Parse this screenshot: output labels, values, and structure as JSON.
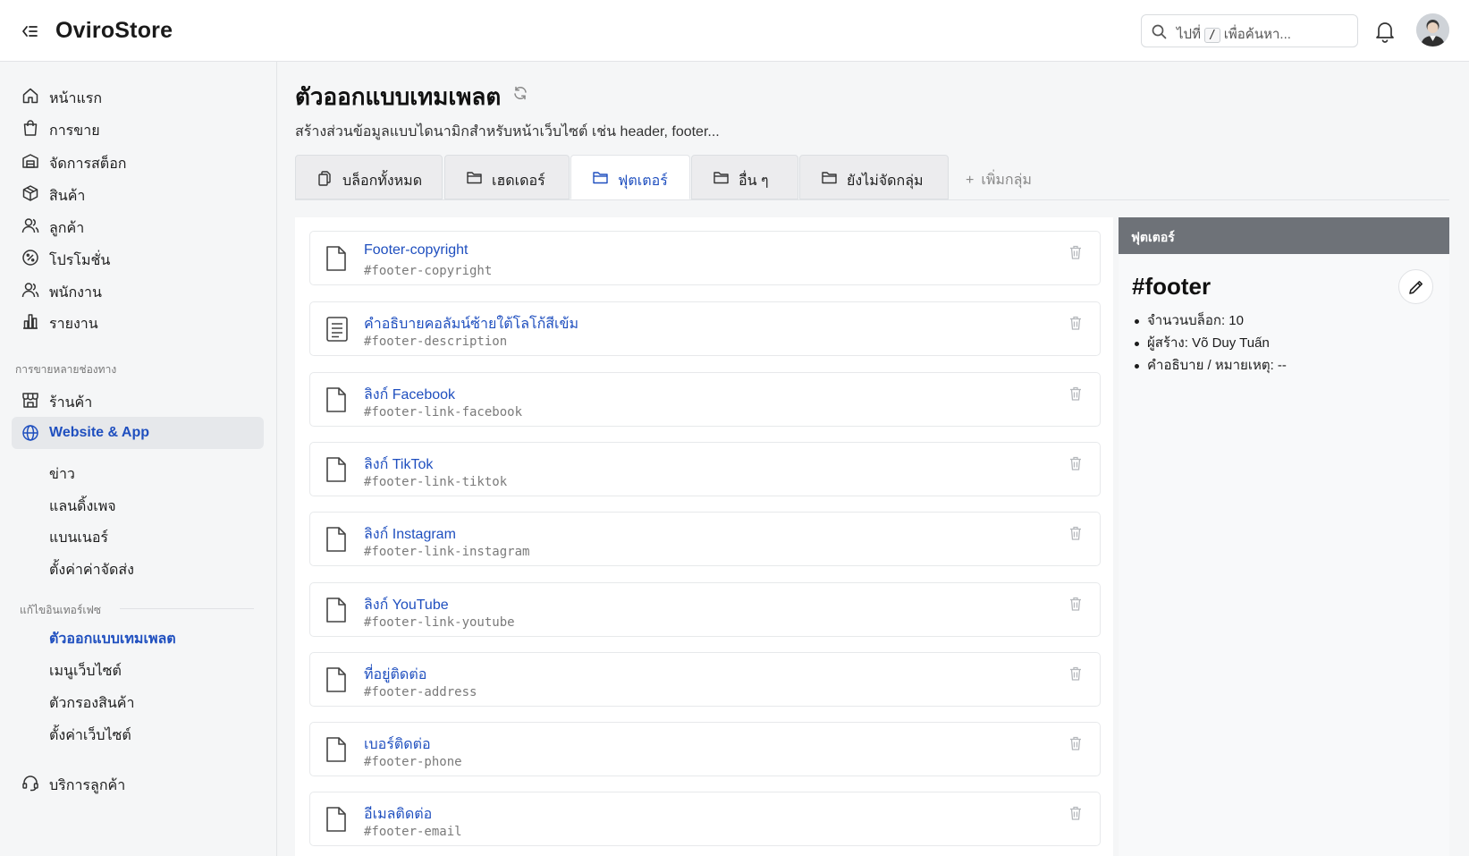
{
  "app": {
    "brand": "OviroStore"
  },
  "search": {
    "prefix": "ไปที่",
    "key": "/",
    "suffix": "เพื่อค้นหา..."
  },
  "sidebar": {
    "items": [
      {
        "label": "หน้าแรก",
        "icon": "home-icon"
      },
      {
        "label": "การขาย",
        "icon": "shopping-bag-icon"
      },
      {
        "label": "จัดการสต็อก",
        "icon": "warehouse-icon"
      },
      {
        "label": "สินค้า",
        "icon": "box-icon"
      },
      {
        "label": "ลูกค้า",
        "icon": "users-icon"
      },
      {
        "label": "โปรโมชั่น",
        "icon": "percent-icon"
      },
      {
        "label": "พนักงาน",
        "icon": "staff-icon"
      },
      {
        "label": "รายงาน",
        "icon": "bar-chart-icon"
      }
    ],
    "section_channels": "การขายหลายช่องทาง",
    "channels": [
      {
        "label": "ร้านค้า",
        "icon": "store-icon"
      },
      {
        "label": "Website & App",
        "icon": "globe-icon"
      }
    ],
    "website_sub": [
      "ข่าว",
      "แลนดิ้งเพจ",
      "แบนเนอร์",
      "ตั้งค่าค่าจัดส่ง"
    ],
    "section_interface": "แก้ไขอินเทอร์เฟซ",
    "interface_sub": [
      "ตัวออกแบบเทมเพลต",
      "เมนูเว็บไซต์",
      "ตัวกรองสินค้า",
      "ตั้งค่าเว็บไซต์"
    ],
    "support": {
      "label": "บริการลูกค้า",
      "icon": "headset-icon"
    }
  },
  "page": {
    "title": "ตัวออกแบบเทมเพลต",
    "subtitle": "สร้างส่วนข้อมูลแบบไดนามิกสำหรับหน้าเว็บไซต์ เช่น header, footer..."
  },
  "tabs": [
    {
      "label": "บล็อกทั้งหมด",
      "icon": "copy-icon"
    },
    {
      "label": "เฮดเดอร์",
      "icon": "folder-icon"
    },
    {
      "label": "ฟุตเตอร์",
      "icon": "folder-icon"
    },
    {
      "label": "อื่น ๆ",
      "icon": "folder-icon"
    },
    {
      "label": "ยังไม่จัดกลุ่ม",
      "icon": "folder-icon"
    }
  ],
  "add_group_label": "เพิ่มกลุ่ม",
  "blocks": [
    {
      "name": "Footer-copyright",
      "code": "#footer-copyright",
      "icon": "file-icon"
    },
    {
      "name": "คำอธิบายคอลัมน์ซ้ายใต้โลโก้สีเข้ม",
      "code": "#footer-description",
      "icon": "file-text-icon"
    },
    {
      "name": "ลิงก์ Facebook",
      "code": "#footer-link-facebook",
      "icon": "file-icon"
    },
    {
      "name": "ลิงก์ TikTok",
      "code": "#footer-link-tiktok",
      "icon": "file-icon"
    },
    {
      "name": "ลิงก์ Instagram",
      "code": "#footer-link-instagram",
      "icon": "file-icon"
    },
    {
      "name": "ลิงก์ YouTube",
      "code": "#footer-link-youtube",
      "icon": "file-icon"
    },
    {
      "name": "ที่อยู่ติดต่อ",
      "code": "#footer-address",
      "icon": "file-icon"
    },
    {
      "name": "เบอร์ติดต่อ",
      "code": "#footer-phone",
      "icon": "file-icon"
    },
    {
      "name": "อีเมลติดต่อ",
      "code": "#footer-email",
      "icon": "file-icon"
    }
  ],
  "detail": {
    "header": "ฟุตเตอร์",
    "title": "#footer",
    "meta": [
      "จำนวนบล็อก: 10",
      "ผู้สร้าง: Võ Duy Tuấn",
      "คำอธิบาย / หมายเหตุ: --"
    ]
  },
  "colors": {
    "accent": "#1f4fbf",
    "detail_header": "#6e7278"
  }
}
